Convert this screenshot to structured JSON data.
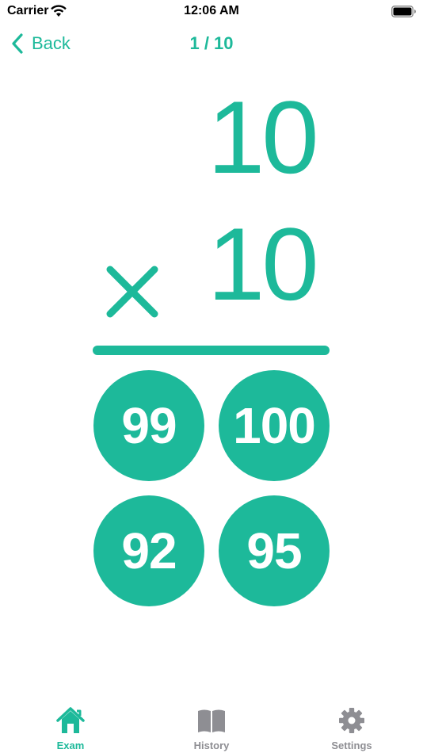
{
  "status_bar": {
    "carrier": "Carrier",
    "time": "12:06 AM"
  },
  "nav": {
    "back_label": "Back",
    "progress": "1 / 10"
  },
  "question": {
    "operand_a": "10",
    "operand_b": "10",
    "operator": "×"
  },
  "answers": [
    "99",
    "100",
    "92",
    "95"
  ],
  "tabs": [
    {
      "label": "Exam",
      "icon": "house-icon",
      "selected": true
    },
    {
      "label": "History",
      "icon": "book-icon",
      "selected": false
    },
    {
      "label": "Settings",
      "icon": "gear-icon",
      "selected": false
    }
  ],
  "colors": {
    "accent": "#1db99a",
    "inactive": "#8e8e93",
    "answer_text": "#ffffff"
  }
}
